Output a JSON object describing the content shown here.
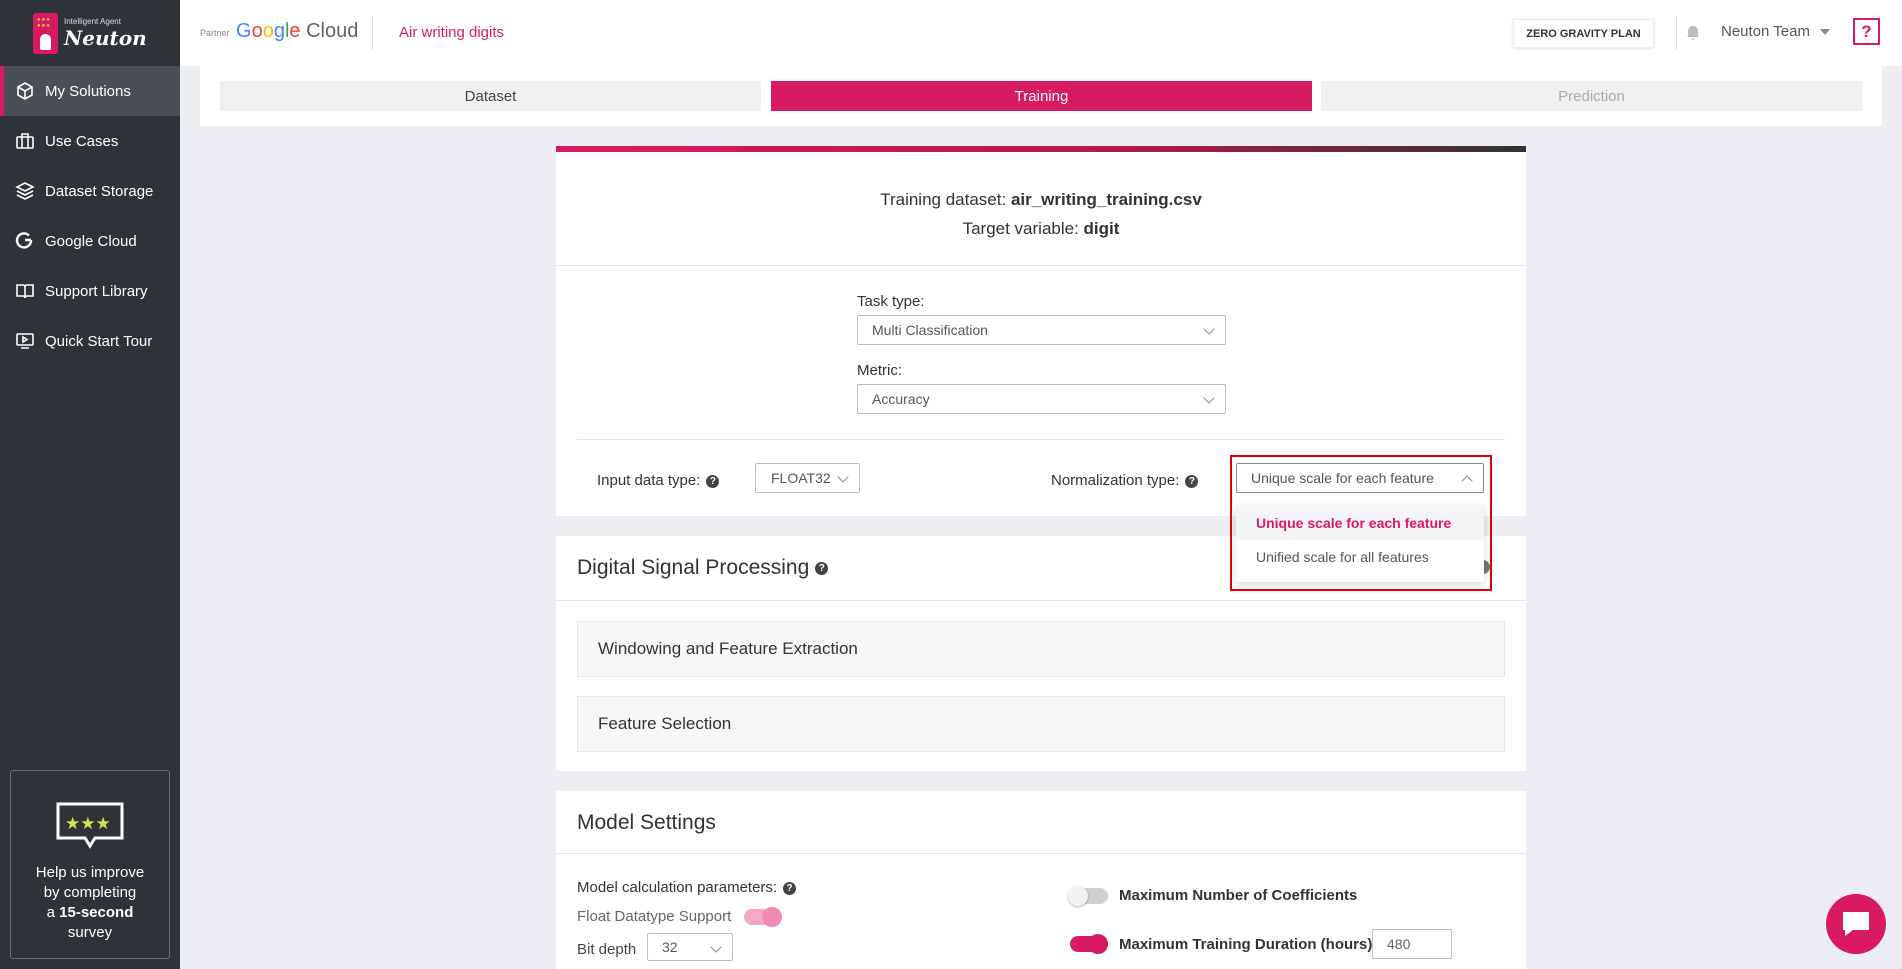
{
  "brand": {
    "sub": "Intelligent Agent",
    "name": "Neuton"
  },
  "sidebar": {
    "items": [
      {
        "label": "My Solutions",
        "icon": "cube-icon"
      },
      {
        "label": "Use Cases",
        "icon": "briefcase-icon"
      },
      {
        "label": "Dataset Storage",
        "icon": "layers-icon"
      },
      {
        "label": "Google Cloud",
        "icon": "google-icon"
      },
      {
        "label": "Support Library",
        "icon": "book-icon"
      },
      {
        "label": "Quick Start Tour",
        "icon": "play-screen-icon"
      }
    ],
    "survey": {
      "line1": "Help us improve",
      "line2": "by completing",
      "line3_pre": "a ",
      "line3_bold": "15-second",
      "line4": "survey"
    }
  },
  "header": {
    "partner": "Partner",
    "cloud_label": "Cloud",
    "project": "Air writing digits",
    "plan": "ZERO GRAVITY PLAN",
    "user": "Neuton Team",
    "help": "?"
  },
  "steps": [
    "Dataset",
    "Training",
    "Prediction"
  ],
  "training": {
    "dataset_label": "Training dataset: ",
    "dataset_file": "air_writing_training.csv",
    "target_label": "Target variable: ",
    "target_value": "digit",
    "task_type_label": "Task type:",
    "task_type_value": "Multi Classification",
    "metric_label": "Metric:",
    "metric_value": "Accuracy",
    "input_type_label": "Input data type:",
    "input_type_value": "FLOAT32",
    "norm_label": "Normalization type:",
    "norm_value": "Unique scale for each feature",
    "norm_options": [
      "Unique scale for each feature",
      "Unified scale for all features"
    ]
  },
  "dsp": {
    "title": "Digital Signal Processing",
    "panels": [
      "Windowing and Feature Extraction",
      "Feature Selection"
    ]
  },
  "model": {
    "title": "Model Settings",
    "calc_label": "Model calculation parameters:",
    "float_support": "Float Datatype Support",
    "bit_depth_label": "Bit depth",
    "bit_depth_value": "32",
    "max_coeff_label": "Maximum Number of Coefficients",
    "max_duration_label": "Maximum Training Duration (hours)",
    "max_duration_value": "480"
  },
  "colors": {
    "accent": "#d81b60",
    "sidebar": "#2f3337",
    "highlight": "#e0000a"
  }
}
